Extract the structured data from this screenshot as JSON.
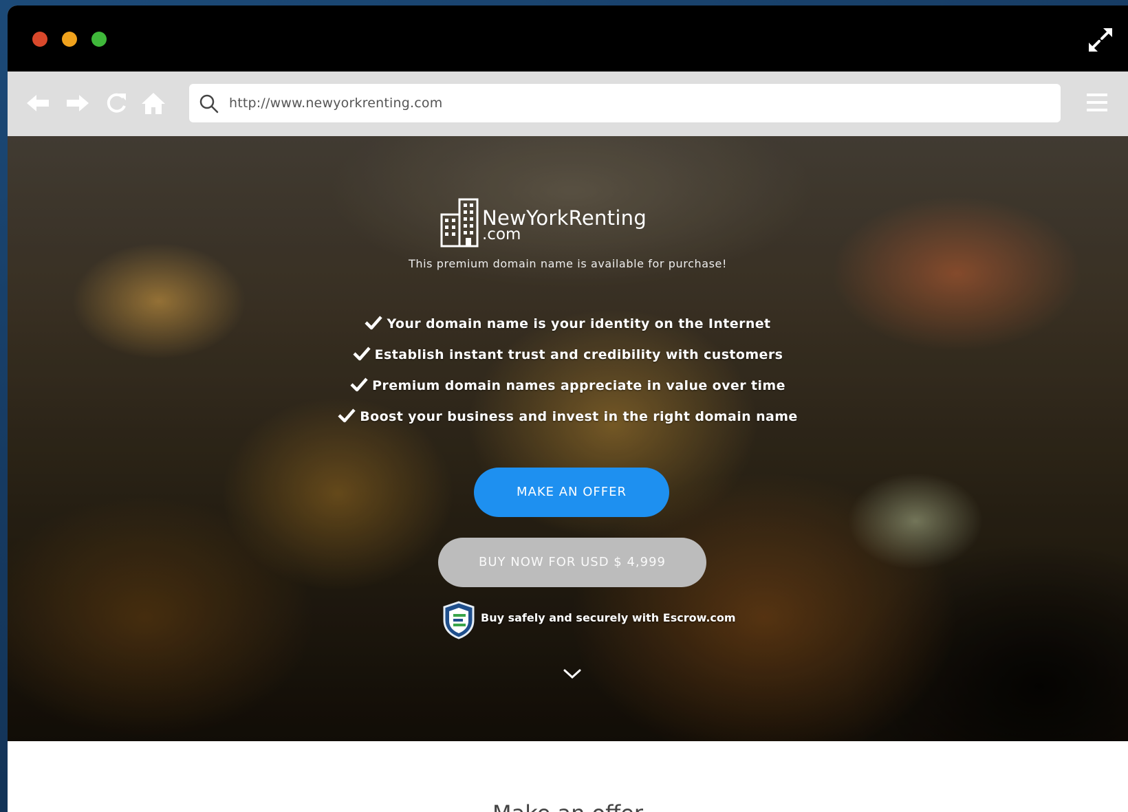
{
  "browser": {
    "url": "http://www.newyorkrenting.com",
    "traffic_lights": [
      "close",
      "minimize",
      "maximize"
    ],
    "colors": {
      "close": "#d9482b",
      "minimize": "#f0a21d",
      "maximize": "#3fb83a"
    }
  },
  "hero": {
    "logo_name": "NewYorkRenting",
    "logo_tld": ".com",
    "tagline": "This premium domain name is available for purchase!",
    "benefits": [
      "Your domain name is your identity on the Internet",
      "Establish instant trust and credibility with customers",
      "Premium domain names appreciate in value over time",
      "Boost your business and invest in the right domain name"
    ],
    "offer_button": "MAKE AN OFFER",
    "buy_button": "BUY NOW FOR USD $ 4,999",
    "escrow_text": "Buy safely and securely with Escrow.com",
    "accent_color": "#1e90f0"
  },
  "below": {
    "heading": "Make an offer"
  }
}
